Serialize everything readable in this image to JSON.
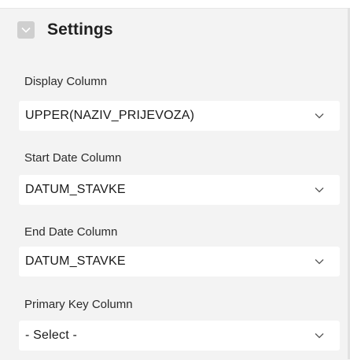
{
  "header": {
    "title": "Settings"
  },
  "fields": [
    {
      "label": "Display Column",
      "value": "UPPER(NAZIV_PRIJEVOZA)"
    },
    {
      "label": "Start Date Column",
      "value": "DATUM_STAVKE"
    },
    {
      "label": "End Date Column",
      "value": "DATUM_STAVKE"
    },
    {
      "label": "Primary Key Column",
      "value": "- Select -"
    }
  ]
}
